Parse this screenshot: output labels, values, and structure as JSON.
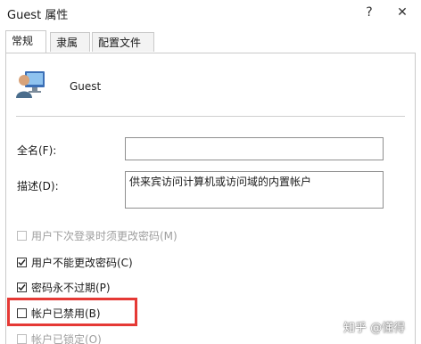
{
  "window": {
    "title": "Guest 属性",
    "help_label": "?",
    "close_label": "✕"
  },
  "tabs": [
    {
      "label": "常规",
      "active": true
    },
    {
      "label": "隶属于",
      "active": false
    },
    {
      "label": "配置文件",
      "active": false
    }
  ],
  "user": {
    "name": "Guest",
    "icon": "user-account-icon"
  },
  "fields": {
    "fullname_label": "全名(F):",
    "fullname_value": "",
    "description_label": "描述(D):",
    "description_value": "供来宾访问计算机或访问域的内置帐户"
  },
  "options": [
    {
      "label": "用户下次登录时须更改密码(M)",
      "checked": false,
      "enabled": false
    },
    {
      "label": "用户不能更改密码(C)",
      "checked": true,
      "enabled": true
    },
    {
      "label": "密码永不过期(P)",
      "checked": true,
      "enabled": true
    },
    {
      "label": "帐户已禁用(B)",
      "checked": false,
      "enabled": true
    },
    {
      "label": "帐户已锁定(O)",
      "checked": false,
      "enabled": false
    }
  ],
  "highlight_color": "#e53935",
  "watermark": "知乎 @懂得"
}
